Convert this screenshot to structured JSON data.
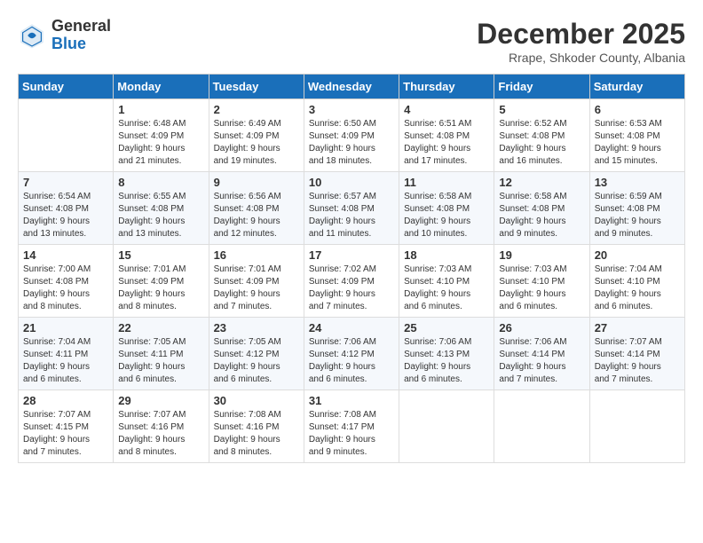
{
  "logo": {
    "general": "General",
    "blue": "Blue"
  },
  "header": {
    "month": "December 2025",
    "location": "Rrape, Shkoder County, Albania"
  },
  "weekdays": [
    "Sunday",
    "Monday",
    "Tuesday",
    "Wednesday",
    "Thursday",
    "Friday",
    "Saturday"
  ],
  "weeks": [
    [
      {
        "day": "",
        "info": ""
      },
      {
        "day": "1",
        "info": "Sunrise: 6:48 AM\nSunset: 4:09 PM\nDaylight: 9 hours\nand 21 minutes."
      },
      {
        "day": "2",
        "info": "Sunrise: 6:49 AM\nSunset: 4:09 PM\nDaylight: 9 hours\nand 19 minutes."
      },
      {
        "day": "3",
        "info": "Sunrise: 6:50 AM\nSunset: 4:09 PM\nDaylight: 9 hours\nand 18 minutes."
      },
      {
        "day": "4",
        "info": "Sunrise: 6:51 AM\nSunset: 4:08 PM\nDaylight: 9 hours\nand 17 minutes."
      },
      {
        "day": "5",
        "info": "Sunrise: 6:52 AM\nSunset: 4:08 PM\nDaylight: 9 hours\nand 16 minutes."
      },
      {
        "day": "6",
        "info": "Sunrise: 6:53 AM\nSunset: 4:08 PM\nDaylight: 9 hours\nand 15 minutes."
      }
    ],
    [
      {
        "day": "7",
        "info": "Sunrise: 6:54 AM\nSunset: 4:08 PM\nDaylight: 9 hours\nand 13 minutes."
      },
      {
        "day": "8",
        "info": "Sunrise: 6:55 AM\nSunset: 4:08 PM\nDaylight: 9 hours\nand 13 minutes."
      },
      {
        "day": "9",
        "info": "Sunrise: 6:56 AM\nSunset: 4:08 PM\nDaylight: 9 hours\nand 12 minutes."
      },
      {
        "day": "10",
        "info": "Sunrise: 6:57 AM\nSunset: 4:08 PM\nDaylight: 9 hours\nand 11 minutes."
      },
      {
        "day": "11",
        "info": "Sunrise: 6:58 AM\nSunset: 4:08 PM\nDaylight: 9 hours\nand 10 minutes."
      },
      {
        "day": "12",
        "info": "Sunrise: 6:58 AM\nSunset: 4:08 PM\nDaylight: 9 hours\nand 9 minutes."
      },
      {
        "day": "13",
        "info": "Sunrise: 6:59 AM\nSunset: 4:08 PM\nDaylight: 9 hours\nand 9 minutes."
      }
    ],
    [
      {
        "day": "14",
        "info": "Sunrise: 7:00 AM\nSunset: 4:08 PM\nDaylight: 9 hours\nand 8 minutes."
      },
      {
        "day": "15",
        "info": "Sunrise: 7:01 AM\nSunset: 4:09 PM\nDaylight: 9 hours\nand 8 minutes."
      },
      {
        "day": "16",
        "info": "Sunrise: 7:01 AM\nSunset: 4:09 PM\nDaylight: 9 hours\nand 7 minutes."
      },
      {
        "day": "17",
        "info": "Sunrise: 7:02 AM\nSunset: 4:09 PM\nDaylight: 9 hours\nand 7 minutes."
      },
      {
        "day": "18",
        "info": "Sunrise: 7:03 AM\nSunset: 4:10 PM\nDaylight: 9 hours\nand 6 minutes."
      },
      {
        "day": "19",
        "info": "Sunrise: 7:03 AM\nSunset: 4:10 PM\nDaylight: 9 hours\nand 6 minutes."
      },
      {
        "day": "20",
        "info": "Sunrise: 7:04 AM\nSunset: 4:10 PM\nDaylight: 9 hours\nand 6 minutes."
      }
    ],
    [
      {
        "day": "21",
        "info": "Sunrise: 7:04 AM\nSunset: 4:11 PM\nDaylight: 9 hours\nand 6 minutes."
      },
      {
        "day": "22",
        "info": "Sunrise: 7:05 AM\nSunset: 4:11 PM\nDaylight: 9 hours\nand 6 minutes."
      },
      {
        "day": "23",
        "info": "Sunrise: 7:05 AM\nSunset: 4:12 PM\nDaylight: 9 hours\nand 6 minutes."
      },
      {
        "day": "24",
        "info": "Sunrise: 7:06 AM\nSunset: 4:12 PM\nDaylight: 9 hours\nand 6 minutes."
      },
      {
        "day": "25",
        "info": "Sunrise: 7:06 AM\nSunset: 4:13 PM\nDaylight: 9 hours\nand 6 minutes."
      },
      {
        "day": "26",
        "info": "Sunrise: 7:06 AM\nSunset: 4:14 PM\nDaylight: 9 hours\nand 7 minutes."
      },
      {
        "day": "27",
        "info": "Sunrise: 7:07 AM\nSunset: 4:14 PM\nDaylight: 9 hours\nand 7 minutes."
      }
    ],
    [
      {
        "day": "28",
        "info": "Sunrise: 7:07 AM\nSunset: 4:15 PM\nDaylight: 9 hours\nand 7 minutes."
      },
      {
        "day": "29",
        "info": "Sunrise: 7:07 AM\nSunset: 4:16 PM\nDaylight: 9 hours\nand 8 minutes."
      },
      {
        "day": "30",
        "info": "Sunrise: 7:08 AM\nSunset: 4:16 PM\nDaylight: 9 hours\nand 8 minutes."
      },
      {
        "day": "31",
        "info": "Sunrise: 7:08 AM\nSunset: 4:17 PM\nDaylight: 9 hours\nand 9 minutes."
      },
      {
        "day": "",
        "info": ""
      },
      {
        "day": "",
        "info": ""
      },
      {
        "day": "",
        "info": ""
      }
    ]
  ]
}
